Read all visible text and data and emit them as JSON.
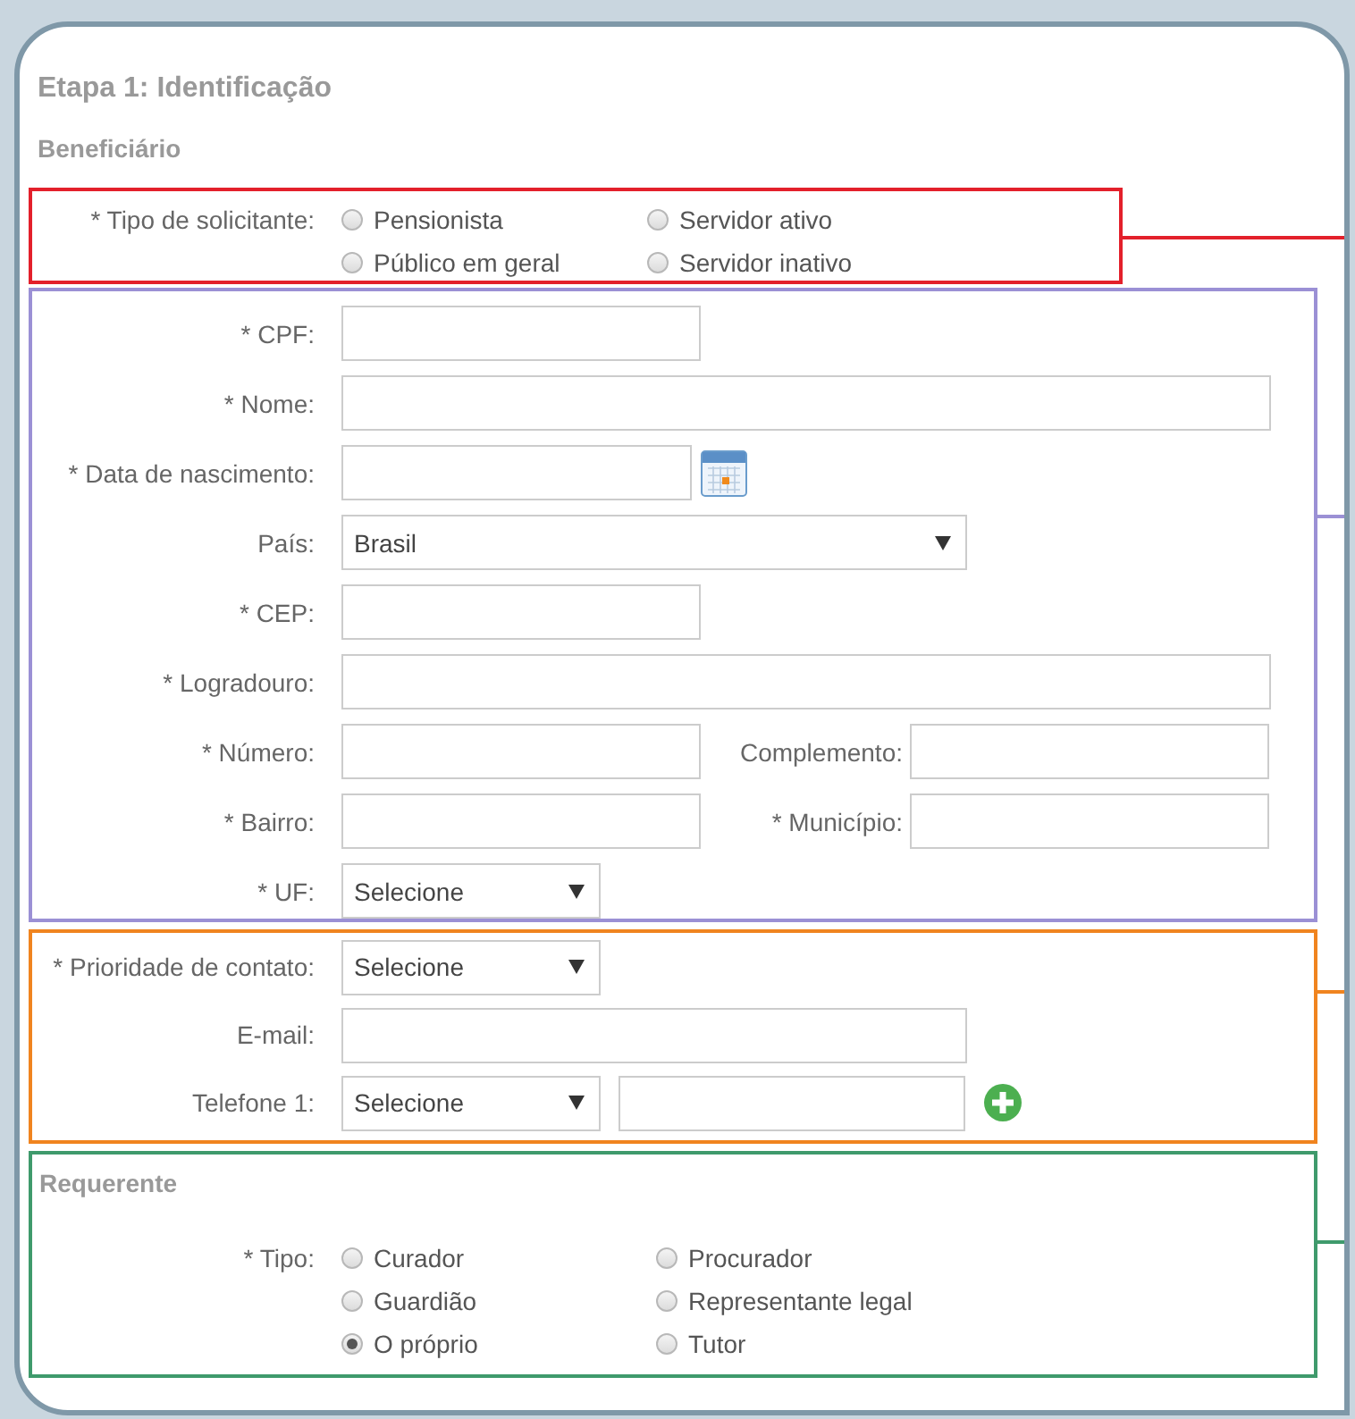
{
  "title": "Etapa 1: Identificação",
  "beneficiary": {
    "heading": "Beneficiário",
    "applicant_type": {
      "label": "* Tipo de solicitante:",
      "options": [
        {
          "label": "Pensionista",
          "selected": false
        },
        {
          "label": "Servidor ativo",
          "selected": false
        },
        {
          "label": "Público em geral",
          "selected": false
        },
        {
          "label": "Servidor inativo",
          "selected": false
        }
      ]
    },
    "fields": [
      {
        "kind": "short",
        "label": "* CPF:"
      },
      {
        "kind": "wide",
        "label": "* Nome:"
      },
      {
        "kind": "date",
        "label": "* Data de nascimento:"
      },
      {
        "kind": "dropdown",
        "label": "País:",
        "value": "Brasil"
      },
      {
        "kind": "short",
        "label": "* CEP:"
      },
      {
        "kind": "wide",
        "label": "* Logradouro:"
      },
      {
        "kind": "pair",
        "label": "* Número:",
        "second_label": "Complemento:"
      },
      {
        "kind": "pair",
        "label": "* Bairro:",
        "second_label": "* Município:"
      },
      {
        "kind": "picker",
        "label": "* UF:",
        "value": "Selecione"
      }
    ],
    "contact": [
      {
        "kind": "picker",
        "label": "* Prioridade de contato:",
        "value": "Selecione"
      },
      {
        "kind": "medium",
        "label": "E-mail:"
      },
      {
        "kind": "phone",
        "label": "Telefone 1:",
        "value": "Selecione"
      }
    ]
  },
  "requester": {
    "heading": "Requerente",
    "type": {
      "label": "* Tipo:",
      "options": [
        {
          "label": "Curador",
          "selected": false
        },
        {
          "label": "Procurador",
          "selected": false
        },
        {
          "label": "Guardião",
          "selected": false
        },
        {
          "label": "Representante legal",
          "selected": false
        },
        {
          "label": "O próprio",
          "selected": true
        },
        {
          "label": "Tutor",
          "selected": false
        }
      ]
    }
  }
}
